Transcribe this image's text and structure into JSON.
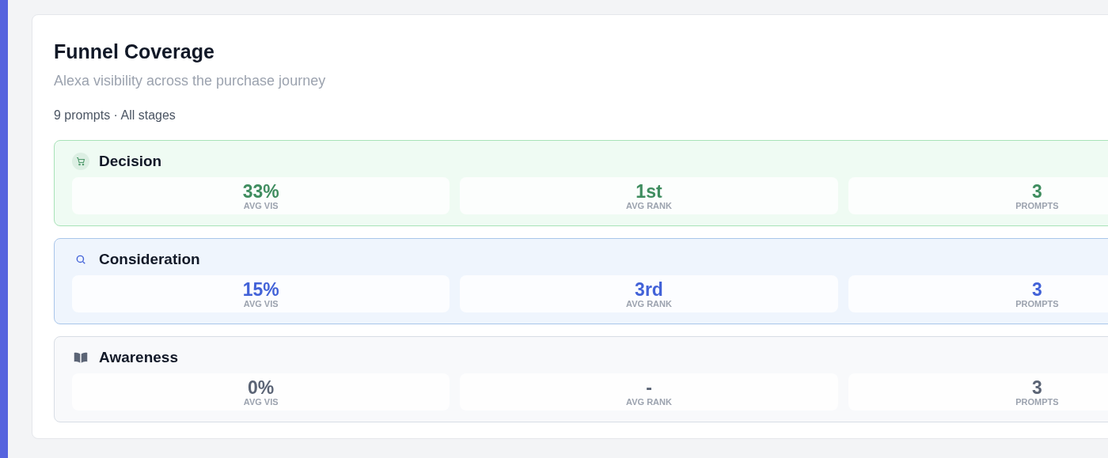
{
  "card": {
    "title": "Funnel Coverage",
    "subtitle": "Alexa visibility across the purchase journey",
    "summary": "9 prompts · All stages"
  },
  "stages": [
    {
      "kind": "decision",
      "name": "Decision",
      "metrics": [
        {
          "value": "33%",
          "label": "AVG VIS"
        },
        {
          "value": "1st",
          "label": "AVG RANK"
        },
        {
          "value": "3",
          "label": "PROMPTS"
        }
      ]
    },
    {
      "kind": "consideration",
      "name": "Consideration",
      "metrics": [
        {
          "value": "15%",
          "label": "AVG VIS"
        },
        {
          "value": "3rd",
          "label": "AVG RANK"
        },
        {
          "value": "3",
          "label": "PROMPTS"
        }
      ]
    },
    {
      "kind": "awareness",
      "name": "Awareness",
      "metrics": [
        {
          "value": "0%",
          "label": "AVG VIS"
        },
        {
          "value": "-",
          "label": "AVG RANK"
        },
        {
          "value": "3",
          "label": "PROMPTS"
        }
      ]
    }
  ]
}
